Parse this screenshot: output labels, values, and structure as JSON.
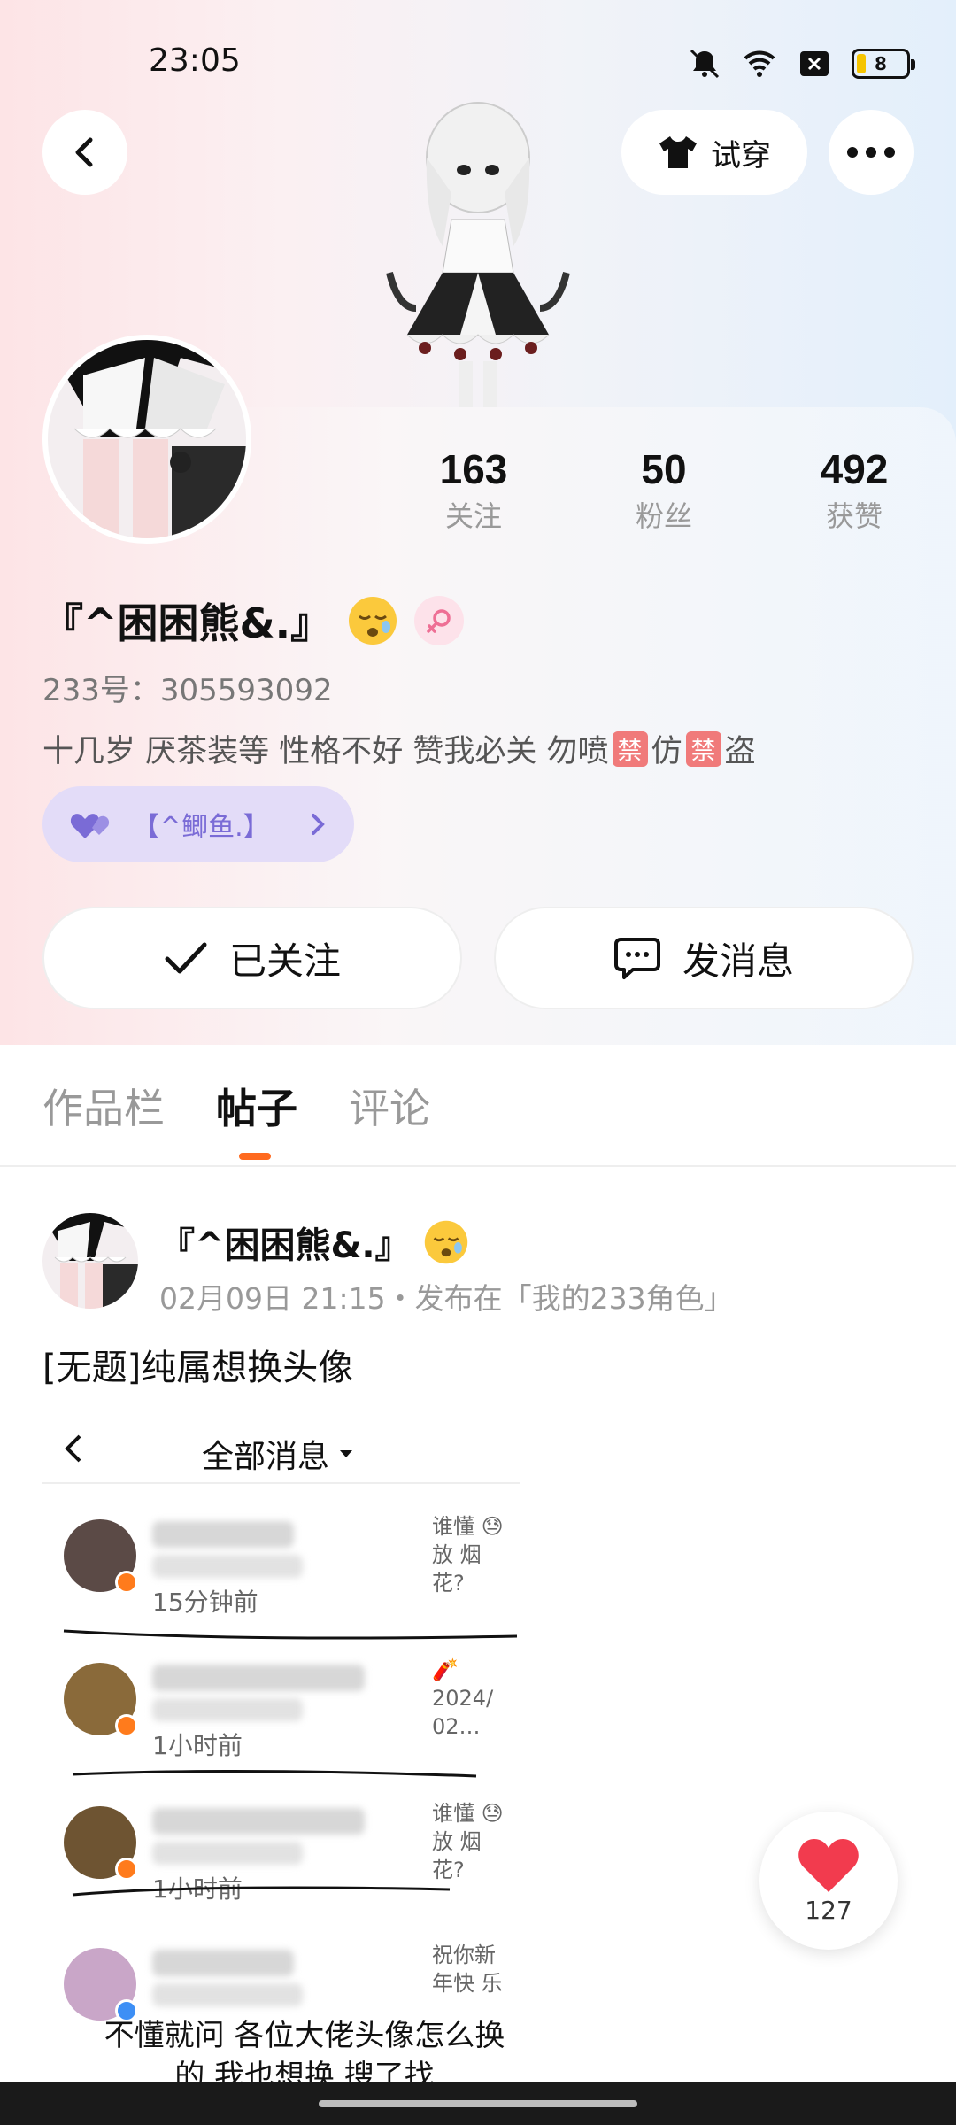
{
  "status_bar": {
    "time": "23:05",
    "battery": "8"
  },
  "header": {
    "tryon_label": "试穿"
  },
  "profile": {
    "stats": [
      {
        "num": "163",
        "label": "关注"
      },
      {
        "num": "50",
        "label": "粉丝"
      },
      {
        "num": "492",
        "label": "获赞"
      }
    ],
    "nickname": "『^困困熊&.』",
    "uid": "233号：305593092",
    "bio_parts": [
      "十几岁 厌茶装等 性格不好 赞我必关 勿喷 ",
      "禁",
      "仿 ",
      "禁",
      "盗"
    ],
    "cp_label": "【^鲫鱼.】",
    "follow_label": "已关注",
    "message_label": "发消息"
  },
  "tabs": [
    "作品栏",
    "帖子",
    "评论"
  ],
  "post": {
    "author": "『^困困熊&.』",
    "meta": "02月09日 21:15・发布在「我的233角色」",
    "title": "[无题]纯属想换头像",
    "embed": {
      "title": "全部消息",
      "items": [
        {
          "time": "15分钟前",
          "preview": "谁懂 😓放 烟花?"
        },
        {
          "time": "1小时前",
          "preview": "🧨2024/ 02…"
        },
        {
          "time": "1小时前",
          "preview": "谁懂 😓放 烟花?"
        },
        {
          "time": "",
          "preview": "祝你新 年快 乐"
        }
      ],
      "bottom_text": "不懂就问 各位大佬头像怎么换的 我也想换 搜了找"
    }
  },
  "like": {
    "count": "127"
  },
  "colors": {
    "accent": "#ff6a1f",
    "cp_text": "#7a6bd6",
    "like_red": "#f23b4e"
  }
}
